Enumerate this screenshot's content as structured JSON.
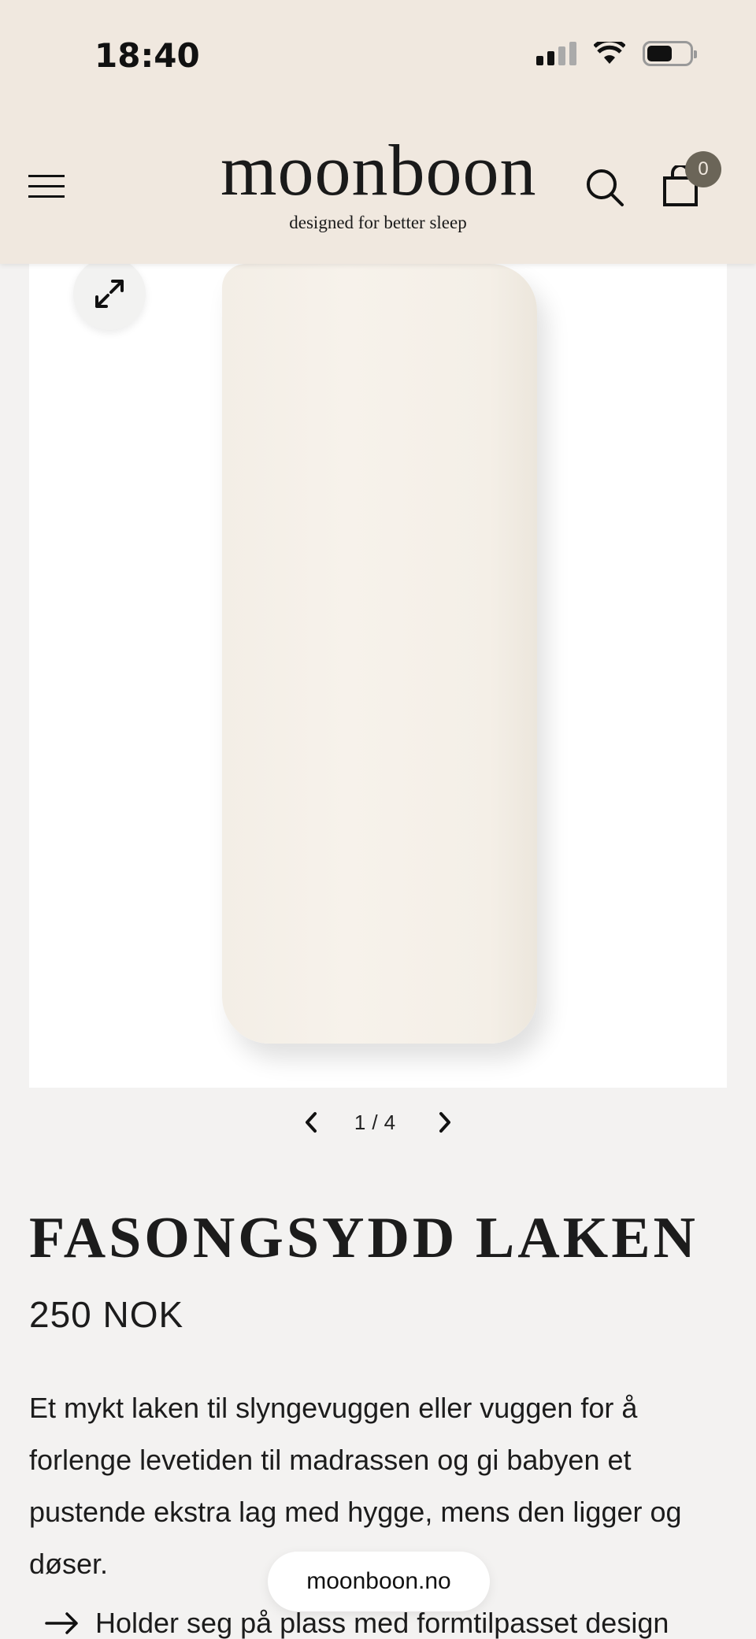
{
  "status_bar": {
    "time": "18:40"
  },
  "header": {
    "brand": "moonboon",
    "tagline": "designed for better sleep",
    "cart_count": "0"
  },
  "gallery": {
    "current": "1",
    "total": "4",
    "separator": "/"
  },
  "product": {
    "title": "FASONGSYDD LAKEN",
    "price": "250 NOK",
    "description": "Et mykt laken til slyngevuggen eller vuggen for å forlenge levetiden til madrassen og gi babyen et pustende ekstra lag med hygge, mens den ligger og døser.",
    "bullets": [
      "Holder seg på plass med formtilpasset design"
    ]
  },
  "browser": {
    "url": "moonboon.no"
  },
  "icons": {
    "menu": "menu-icon",
    "search": "search-icon",
    "cart": "cart-icon",
    "expand": "expand-icon",
    "prev": "chevron-left-icon",
    "next": "chevron-right-icon",
    "bullet": "arrow-right-icon"
  },
  "colors": {
    "header_bg": "#f0e8df",
    "badge_bg": "#6b6558",
    "page_bg": "#f3f2f1"
  }
}
